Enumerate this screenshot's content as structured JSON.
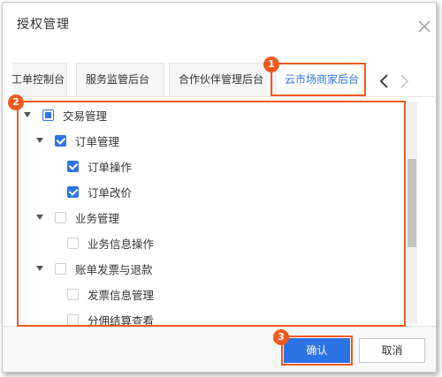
{
  "dialog": {
    "title": "授权管理",
    "close_icon": "close-icon"
  },
  "tabs": [
    {
      "label": "工单控制台"
    },
    {
      "label": "服务监管后台"
    },
    {
      "label": "合作伙伴管理后台"
    },
    {
      "label": "云市场商家后台",
      "active": true
    }
  ],
  "tree": {
    "items": [
      {
        "label": "交易管理",
        "state": "half"
      },
      {
        "label": "订单管理",
        "state": "on"
      },
      {
        "label": "订单操作",
        "state": "on"
      },
      {
        "label": "订单改价",
        "state": "on"
      },
      {
        "label": "业务管理",
        "state": "off"
      },
      {
        "label": "业务信息操作",
        "state": "off"
      },
      {
        "label": "账单发票与退款",
        "state": "off"
      },
      {
        "label": "发票信息管理",
        "state": "off"
      },
      {
        "label": "分佣结算查看",
        "state": "off"
      }
    ]
  },
  "footer": {
    "confirm_label": "确认",
    "cancel_label": "取消"
  },
  "annotations": {
    "badges": [
      "1",
      "2",
      "3"
    ],
    "color": "#f05a1e"
  },
  "colors": {
    "accent": "#2e73e6"
  }
}
